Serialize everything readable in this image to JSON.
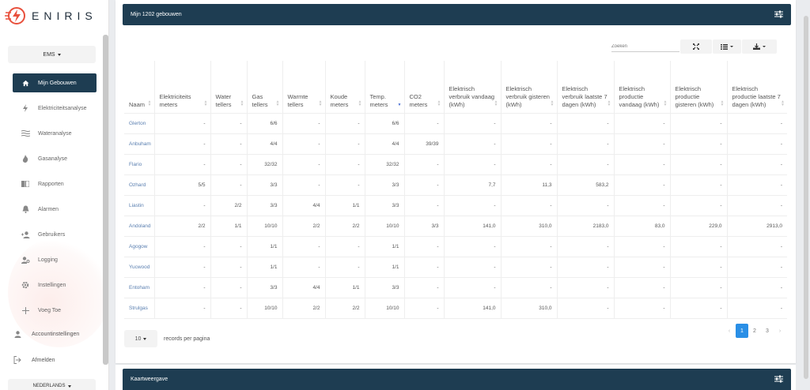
{
  "app": {
    "logo_text": "ENIRIS",
    "ems_select": "EMS",
    "language": "NEDERLANDS"
  },
  "sidebar": {
    "items": [
      {
        "label": "Mijn Gebouwen",
        "icon": "home-icon",
        "active": true
      },
      {
        "label": "Elektriciteitsanalyse",
        "icon": "bolt-icon"
      },
      {
        "label": "Wateranalyse",
        "icon": "water-icon"
      },
      {
        "label": "Gasanalyse",
        "icon": "flame-icon"
      },
      {
        "label": "Rapporten",
        "icon": "book-icon"
      },
      {
        "label": "Alarmen",
        "icon": "bell-icon"
      },
      {
        "label": "Gebruikers",
        "icon": "user-plus-icon"
      },
      {
        "label": "Logging",
        "icon": "user-search-icon"
      },
      {
        "label": "Instellingen",
        "icon": "gear-icon"
      },
      {
        "label": "Voeg Toe",
        "icon": "plus-icon"
      }
    ],
    "account": "Accountinstellingen",
    "logout": "Afmelden"
  },
  "panel": {
    "title": "Mijn 1202 gebouwen",
    "search_placeholder": "Zoeken",
    "columns": [
      "Naam",
      "Elektriciteits meters",
      "Water tellers",
      "Gas tellers",
      "Warmte tellers",
      "Koude meters",
      "Temp. meters",
      "CO2 meters",
      "Elektrisch verbruik vandaag (kWh)",
      "Elektrisch verbruik gisteren (kWh)",
      "Elektrisch verbruik laatste 7 dagen (kWh)",
      "Elektrisch productie vandaag (kWh)",
      "Elektrisch productie gisteren (kWh)",
      "Elektrisch productie laatste 7 dagen (kWh)"
    ],
    "rows": [
      [
        "Glerton",
        "-",
        "-",
        "6/6",
        "-",
        "-",
        "6/6",
        "-",
        "-",
        "-",
        "-",
        "-",
        "-",
        "-"
      ],
      [
        "Anbuham",
        "-",
        "-",
        "4/4",
        "-",
        "-",
        "4/4",
        "39/39",
        "-",
        "-",
        "-",
        "-",
        "-",
        "-"
      ],
      [
        "Flario",
        "-",
        "-",
        "32/32",
        "-",
        "-",
        "32/32",
        "-",
        "-",
        "-",
        "-",
        "-",
        "-",
        "-"
      ],
      [
        "Ozhard",
        "5/5",
        "-",
        "3/3",
        "-",
        "-",
        "3/3",
        "-",
        "7,7",
        "11,3",
        "583,2",
        "-",
        "-",
        "-"
      ],
      [
        "Liastin",
        "-",
        "2/2",
        "3/3",
        "4/4",
        "1/1",
        "3/3",
        "-",
        "-",
        "-",
        "-",
        "-",
        "-",
        "-"
      ],
      [
        "Andoland",
        "2/2",
        "1/1",
        "10/10",
        "2/2",
        "2/2",
        "10/10",
        "3/3",
        "141,0",
        "310,0",
        "2183,0",
        "83,0",
        "229,0",
        "2913,0"
      ],
      [
        "Agogow",
        "-",
        "-",
        "1/1",
        "-",
        "-",
        "1/1",
        "-",
        "-",
        "-",
        "-",
        "-",
        "-",
        "-"
      ],
      [
        "Yucwood",
        "-",
        "-",
        "1/1",
        "-",
        "-",
        "1/1",
        "-",
        "-",
        "-",
        "-",
        "-",
        "-",
        "-"
      ],
      [
        "Entoham",
        "-",
        "-",
        "3/3",
        "4/4",
        "1/1",
        "3/3",
        "-",
        "-",
        "-",
        "-",
        "-",
        "-",
        "-"
      ],
      [
        "Strulgas",
        "-",
        "-",
        "10/10",
        "2/2",
        "2/2",
        "10/10",
        "-",
        "141,0",
        "310,0",
        "-",
        "-",
        "-",
        "-"
      ]
    ],
    "records_value": "10",
    "records_label": "records per pagina",
    "pages": [
      "1",
      "2",
      "3"
    ],
    "pager_prev": "‹",
    "pager_next": "›"
  },
  "panel2": {
    "title": "Kaartweergave"
  },
  "colors": {
    "header": "#1e3d52",
    "accent": "#2a8fe6",
    "link": "#5a7fb0"
  }
}
